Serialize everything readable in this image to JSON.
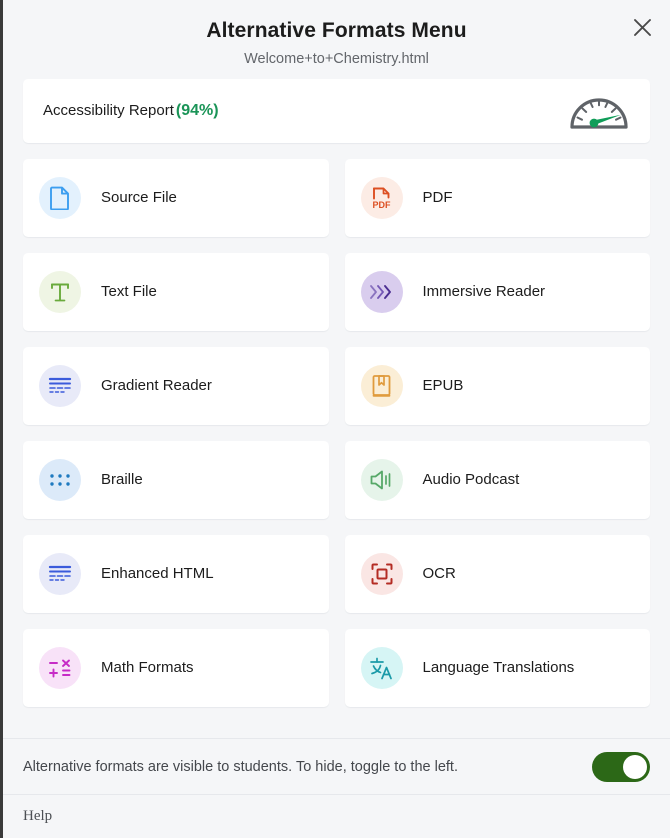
{
  "header": {
    "title": "Alternative Formats Menu",
    "subtitle": "Welcome+to+Chemistry.html",
    "close_icon": "close-icon"
  },
  "report": {
    "label": "Accessibility Report",
    "percent": "(94%)",
    "percent_color": "#1a9457",
    "icon": "gauge-icon",
    "gauge_needle_color": "#1a9457",
    "gauge_dial_color": "#5f6368"
  },
  "formats": [
    {
      "label": "Source File",
      "icon": "document-icon",
      "icon_color": "#3c9ef0",
      "circle_color": "#e3f1fd"
    },
    {
      "label": "PDF",
      "icon": "pdf-file-icon",
      "icon_color": "#dc4f22",
      "circle_color": "#fcece5"
    },
    {
      "label": "Text File",
      "icon": "text-t-icon",
      "icon_color": "#6aaa3c",
      "circle_color": "#eff5e4"
    },
    {
      "label": "Immersive Reader",
      "icon": "chevrons-right-icon",
      "icon_color": "#5c3da8",
      "circle_color": "#d9cdee"
    },
    {
      "label": "Gradient Reader",
      "icon": "text-lines-icon",
      "icon_color": "#3b5bdb",
      "circle_color": "#e8eaf8"
    },
    {
      "label": "EPUB",
      "icon": "book-bookmark-icon",
      "icon_color": "#e09b3d",
      "circle_color": "#fbeed6"
    },
    {
      "label": "Braille",
      "icon": "braille-dots-icon",
      "icon_color": "#1f7ac0",
      "circle_color": "#dceaf9"
    },
    {
      "label": "Audio Podcast",
      "icon": "speaker-sound-icon",
      "icon_color": "#56a868",
      "circle_color": "#e6f4ea"
    },
    {
      "label": "Enhanced HTML",
      "icon": "text-lines-icon",
      "icon_color": "#3b5bdb",
      "circle_color": "#e8eaf8"
    },
    {
      "label": "OCR",
      "icon": "scan-frame-icon",
      "icon_color": "#b42c24",
      "circle_color": "#fae6e4"
    },
    {
      "label": "Math Formats",
      "icon": "math-symbols-icon",
      "icon_color": "#c62bc6",
      "circle_color": "#f8e2f8"
    },
    {
      "label": "Language Translations",
      "icon": "translate-icon",
      "icon_color": "#1b9aa8",
      "circle_color": "#d6f5f5"
    }
  ],
  "footer": {
    "toggle_text": "Alternative formats are visible to students. To hide, toggle to the left.",
    "toggle_state": "on",
    "toggle_color": "#2c6817",
    "help_label": "Help"
  }
}
